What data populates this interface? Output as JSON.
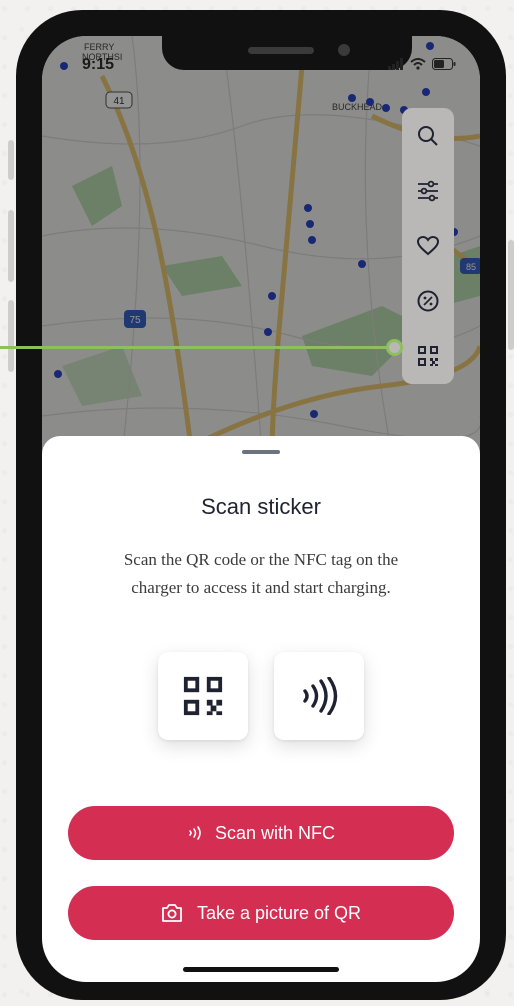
{
  "status_bar": {
    "time": "9:15"
  },
  "map": {
    "labels": {
      "ferry": "FERRY",
      "northside": "NORTHSI",
      "buckhead": "BUCKHEAD",
      "route_41": "41",
      "route_75": "75",
      "route_85": "85"
    },
    "pin_color": "#2b45c8"
  },
  "toolbar": {
    "items": [
      {
        "icon": "search-icon"
      },
      {
        "icon": "filter-sliders-icon"
      },
      {
        "icon": "heart-icon"
      },
      {
        "icon": "discount-icon"
      },
      {
        "icon": "qr-code-icon"
      }
    ]
  },
  "sheet": {
    "title": "Scan sticker",
    "description": "Scan the QR code or the NFC tag on the charger to access it and start charging.",
    "options": [
      {
        "icon": "qr-code-icon"
      },
      {
        "icon": "nfc-icon"
      }
    ],
    "buttons": {
      "nfc_label": "Scan with NFC",
      "qr_label": "Take a picture of QR"
    }
  },
  "colors": {
    "accent": "#d42f52",
    "callout": "#8fbe5f"
  }
}
